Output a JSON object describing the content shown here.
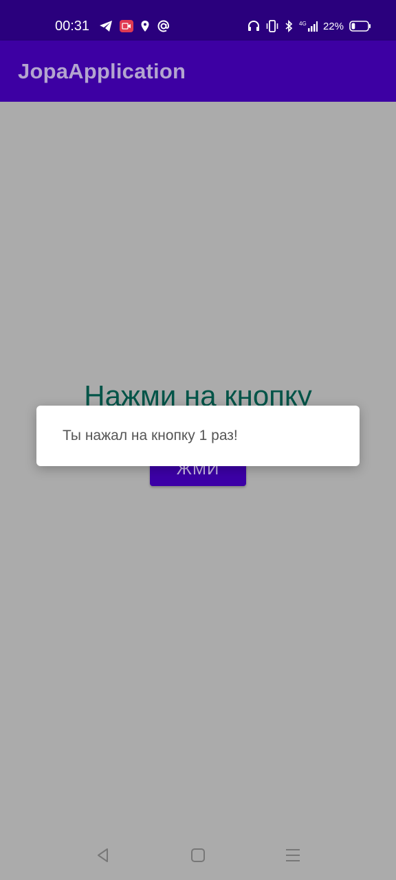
{
  "status_bar": {
    "time": "00:31",
    "left_icons": [
      "telegram-icon",
      "screen-record-icon",
      "location-icon",
      "at-sign-icon"
    ],
    "network": "4G",
    "battery_percent": "22%",
    "battery_level": 0.22,
    "right_icons": [
      "headphones-icon",
      "vibrate-icon",
      "bluetooth-icon",
      "signal-icon",
      "battery-icon"
    ]
  },
  "app_bar": {
    "title": "JopaApplication"
  },
  "main": {
    "headline": "Нажми на кнопку",
    "button_label": "ЖМИ"
  },
  "toast": {
    "message": "Ты нажал на кнопку 1 раз!"
  },
  "nav_bar": {
    "buttons": [
      "back",
      "home",
      "recents"
    ]
  },
  "colors": {
    "status_bar": "#2a007d",
    "app_bar": "#3d00a3",
    "button": "#3c00a6",
    "headline": "#025448",
    "scrim_background": "#ababab"
  }
}
